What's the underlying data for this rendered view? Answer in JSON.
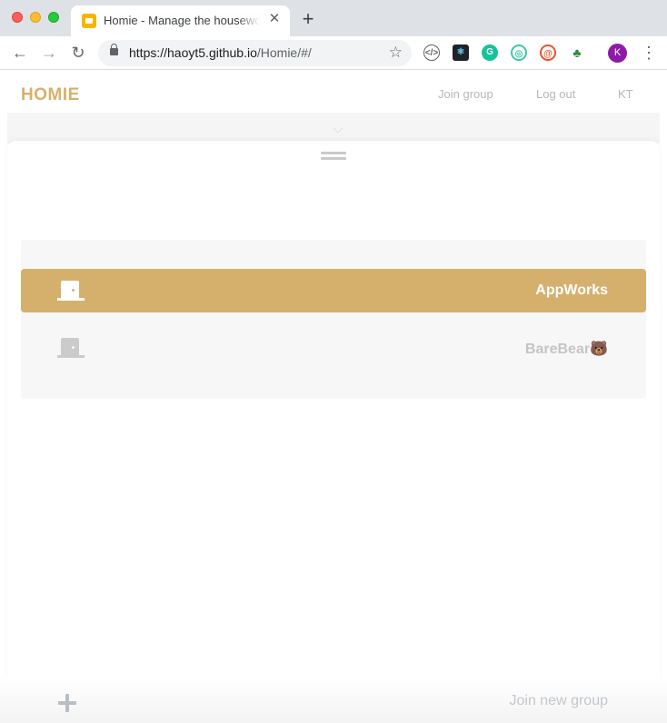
{
  "browser": {
    "tab_title": "Homie - Manage the housework",
    "tab_close": "✕",
    "new_tab": "+",
    "url_host": "https://haoyt5.github.io",
    "url_path": "/Homie/#/",
    "back": "←",
    "forward": "→",
    "reload": "↻",
    "star": "☆",
    "avatar_initial": "K",
    "menu": "⋮",
    "extensions": [
      "code-extension-icon",
      "react-devtools-icon",
      "grammarly-icon",
      "extension-target-icon",
      "extension-swirl-icon",
      "extension-leaf-icon"
    ]
  },
  "header": {
    "logo": "HOMIE",
    "join_group": "Join group",
    "log_out": "Log out",
    "user_initials": "KT"
  },
  "groups": [
    {
      "name": "AppWorks",
      "active": true
    },
    {
      "name": "BareBear🐻",
      "active": false
    }
  ],
  "footer": {
    "join_new_group": "Join new group"
  },
  "colors": {
    "brand": "#d7b06c",
    "active_row": "#d5b06d",
    "muted_text": "#b7b7b7"
  }
}
